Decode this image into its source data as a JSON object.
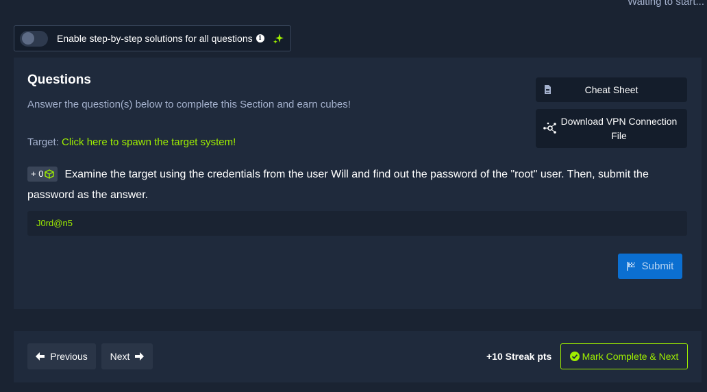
{
  "status_text": "Waiting to start...",
  "toggle": {
    "label": "Enable step-by-step solutions for all questions",
    "state": "off"
  },
  "questions": {
    "title": "Questions",
    "subtitle": "Answer the question(s) below to complete this Section and earn cubes!",
    "target_prefix": "Target: ",
    "target_link": "Click here to spawn the target system!",
    "cheat_sheet_label": "Cheat Sheet",
    "vpn_label": "Download VPN Connection File",
    "items": [
      {
        "cube_badge": "+ 0",
        "text": "Examine the target using the credentials from the user Will and find out the password of the \"root\" user. Then, submit the password as the answer.",
        "answer": "J0rd@n5",
        "submit_label": "Submit"
      }
    ]
  },
  "footer": {
    "previous_label": "Previous",
    "next_label": "Next",
    "streak_text": "+10 Streak pts",
    "mark_complete_label": "Mark Complete & Next"
  },
  "colors": {
    "accent": "#9fef00",
    "background": "#1a2332",
    "card": "#1f2a3c",
    "submit": "#0b6fd1"
  }
}
